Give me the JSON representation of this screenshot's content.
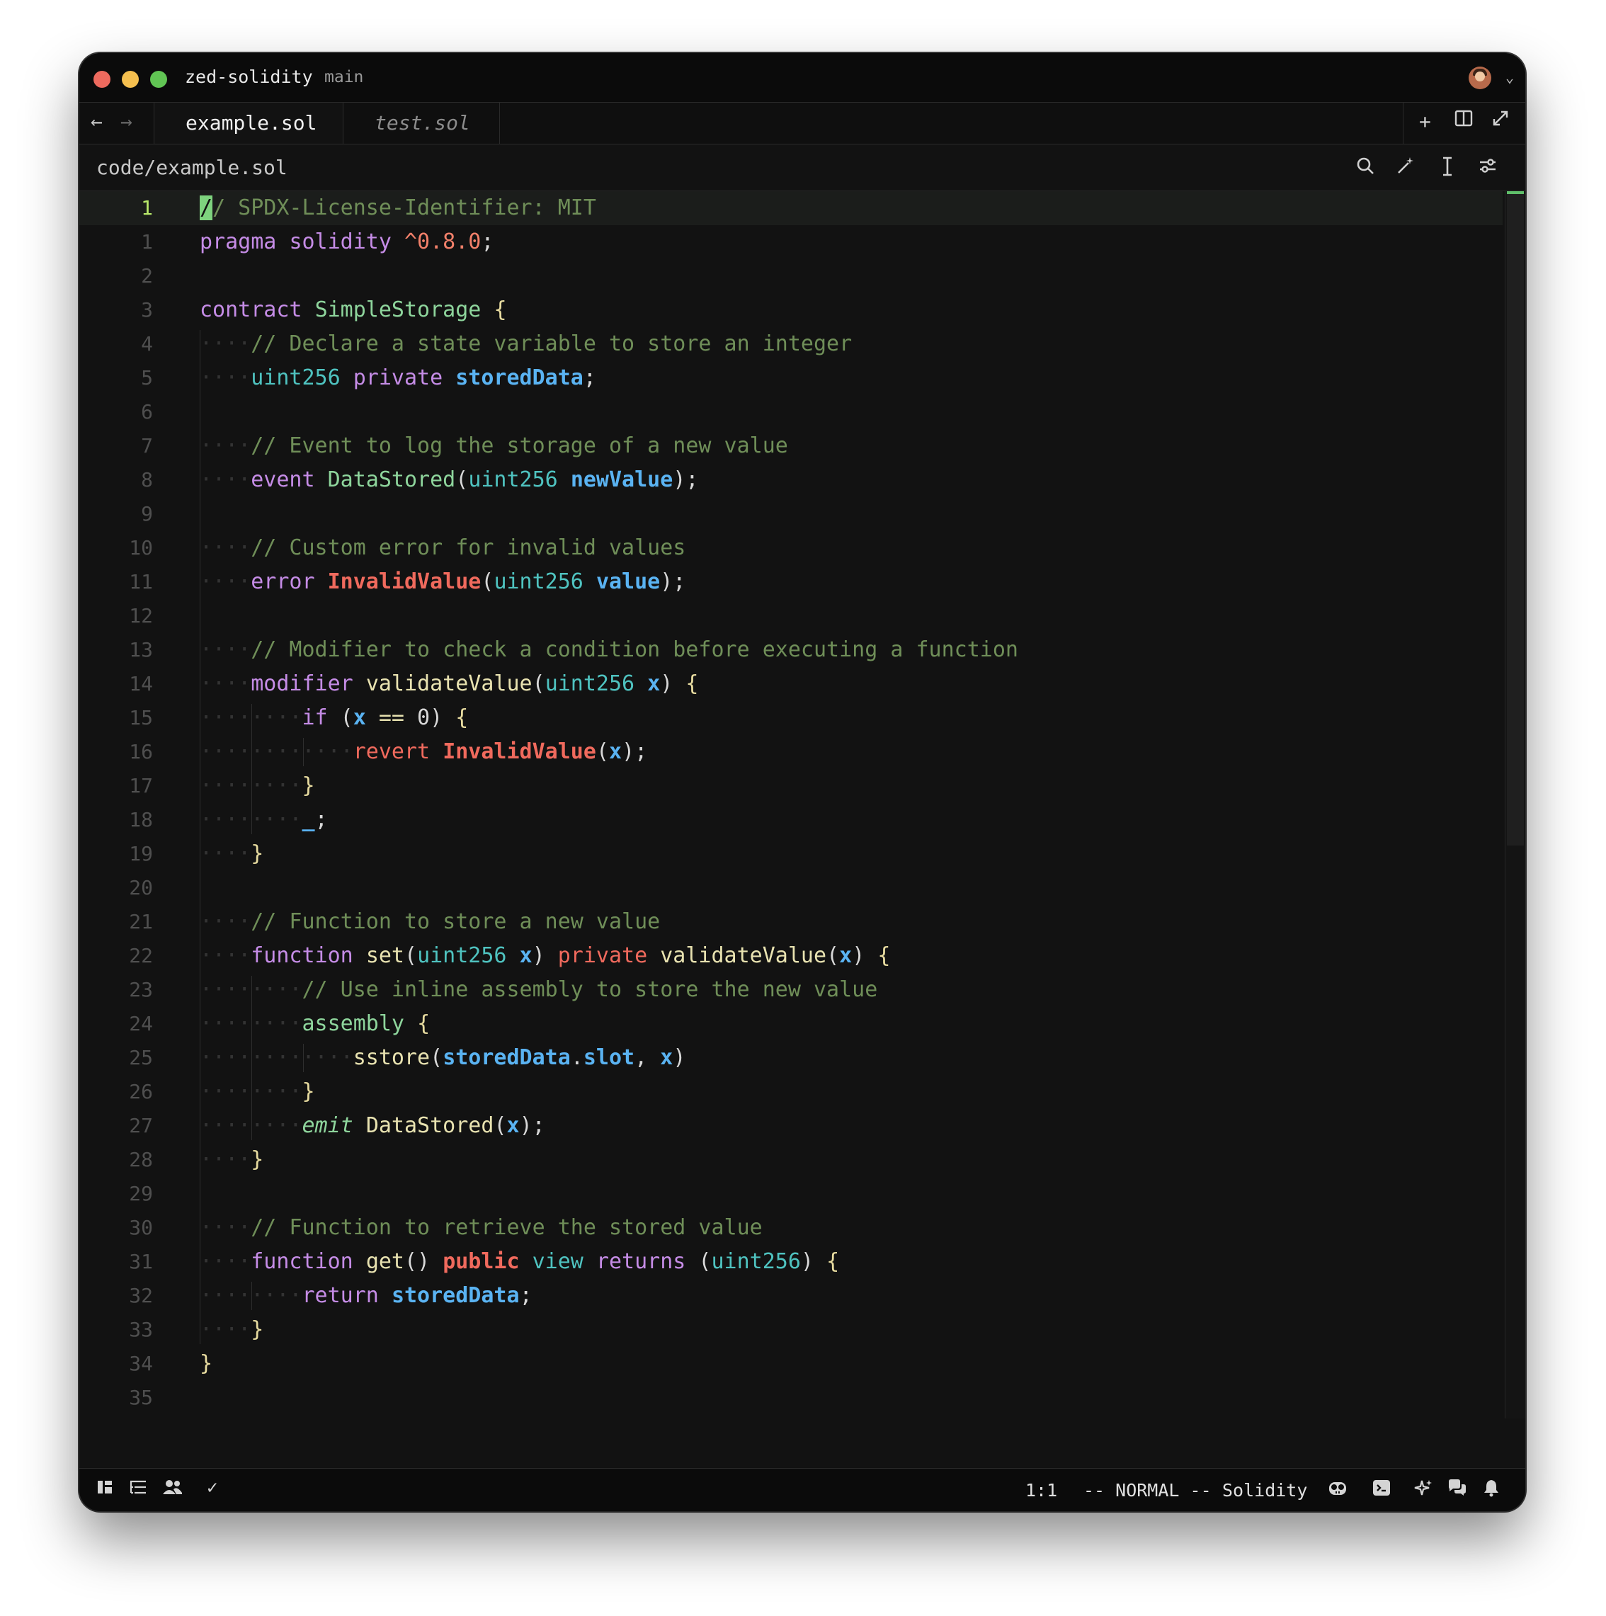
{
  "titlebar": {
    "project": "zed-solidity",
    "branch": "main"
  },
  "tabs": [
    {
      "label": "example.sol",
      "active": true
    },
    {
      "label": "test.sol",
      "active": false
    }
  ],
  "breadcrumb": "code/example.sol",
  "editor": {
    "current_line_number": "1",
    "line_numbers": [
      "1",
      "1",
      "2",
      "3",
      "4",
      "5",
      "6",
      "7",
      "8",
      "9",
      "10",
      "11",
      "12",
      "13",
      "14",
      "15",
      "16",
      "17",
      "18",
      "19",
      "20",
      "21",
      "22",
      "23",
      "24",
      "25",
      "26",
      "27",
      "28",
      "29",
      "30",
      "31",
      "32",
      "33",
      "34",
      "35"
    ],
    "lines": [
      [
        {
          "t": "/",
          "c": "cursor"
        },
        {
          "t": "/ SPDX-License-Identifier: MIT",
          "c": "c-com"
        }
      ],
      [
        {
          "t": "pragma",
          "c": "c-kw"
        },
        {
          "t": " "
        },
        {
          "t": "solidity",
          "c": "c-kw"
        },
        {
          "t": " "
        },
        {
          "t": "^0.8.0",
          "c": "c-num"
        },
        {
          "t": ";",
          "c": "c-punc"
        }
      ],
      [],
      [
        {
          "t": "contract",
          "c": "c-kw"
        },
        {
          "t": " "
        },
        {
          "t": "SimpleStorage",
          "c": "c-con"
        },
        {
          "t": " "
        },
        {
          "t": "{",
          "c": "c-brace"
        }
      ],
      [
        {
          "t": "····",
          "c": "dots"
        },
        {
          "t": "// Declare a state variable to store an integer",
          "c": "c-com"
        }
      ],
      [
        {
          "t": "····",
          "c": "dots"
        },
        {
          "t": "uint256",
          "c": "c-type"
        },
        {
          "t": " "
        },
        {
          "t": "private",
          "c": "c-kw"
        },
        {
          "t": " "
        },
        {
          "t": "storedData",
          "c": "c-var"
        },
        {
          "t": ";",
          "c": "c-punc"
        }
      ],
      [],
      [
        {
          "t": "····",
          "c": "dots"
        },
        {
          "t": "// Event to log the storage of a new value",
          "c": "c-com"
        }
      ],
      [
        {
          "t": "····",
          "c": "dots"
        },
        {
          "t": "event",
          "c": "c-kw"
        },
        {
          "t": " "
        },
        {
          "t": "DataStored",
          "c": "c-con"
        },
        {
          "t": "(",
          "c": "c-punc"
        },
        {
          "t": "uint256",
          "c": "c-type"
        },
        {
          "t": " "
        },
        {
          "t": "newValue",
          "c": "c-var"
        },
        {
          "t": ");",
          "c": "c-punc"
        }
      ],
      [],
      [
        {
          "t": "····",
          "c": "dots"
        },
        {
          "t": "// Custom error for invalid values",
          "c": "c-com"
        }
      ],
      [
        {
          "t": "····",
          "c": "dots"
        },
        {
          "t": "error",
          "c": "c-kw"
        },
        {
          "t": " "
        },
        {
          "t": "InvalidValue",
          "c": "c-err"
        },
        {
          "t": "(",
          "c": "c-punc"
        },
        {
          "t": "uint256",
          "c": "c-type"
        },
        {
          "t": " "
        },
        {
          "t": "value",
          "c": "c-var"
        },
        {
          "t": ");",
          "c": "c-punc"
        }
      ],
      [],
      [
        {
          "t": "····",
          "c": "dots"
        },
        {
          "t": "// Modifier to check a condition before executing a function",
          "c": "c-com"
        }
      ],
      [
        {
          "t": "····",
          "c": "dots"
        },
        {
          "t": "modifier",
          "c": "c-kw"
        },
        {
          "t": " "
        },
        {
          "t": "validateValue",
          "c": "c-fn"
        },
        {
          "t": "(",
          "c": "c-punc"
        },
        {
          "t": "uint256",
          "c": "c-type"
        },
        {
          "t": " "
        },
        {
          "t": "x",
          "c": "c-var"
        },
        {
          "t": ") ",
          "c": "c-punc"
        },
        {
          "t": "{",
          "c": "c-brace"
        }
      ],
      [
        {
          "t": "········",
          "c": "dots"
        },
        {
          "t": "if",
          "c": "c-kw"
        },
        {
          "t": " ("
        },
        {
          "t": "x",
          "c": "c-var"
        },
        {
          "t": " "
        },
        {
          "t": "==",
          "c": "c-fn"
        },
        {
          "t": " 0) "
        },
        {
          "t": "{",
          "c": "c-brace"
        }
      ],
      [
        {
          "t": "············",
          "c": "dots"
        },
        {
          "t": "revert",
          "c": "c-red"
        },
        {
          "t": " "
        },
        {
          "t": "InvalidValue",
          "c": "c-err"
        },
        {
          "t": "(",
          "c": "c-punc"
        },
        {
          "t": "x",
          "c": "c-var"
        },
        {
          "t": ");",
          "c": "c-punc"
        }
      ],
      [
        {
          "t": "········",
          "c": "dots"
        },
        {
          "t": "}",
          "c": "c-brace"
        }
      ],
      [
        {
          "t": "········",
          "c": "dots"
        },
        {
          "t": "_",
          "c": "c-var"
        },
        {
          "t": ";",
          "c": "c-punc"
        }
      ],
      [
        {
          "t": "····",
          "c": "dots"
        },
        {
          "t": "}",
          "c": "c-brace"
        }
      ],
      [],
      [
        {
          "t": "····",
          "c": "dots"
        },
        {
          "t": "// Function to store a new value",
          "c": "c-com"
        }
      ],
      [
        {
          "t": "····",
          "c": "dots"
        },
        {
          "t": "function",
          "c": "c-kw"
        },
        {
          "t": " "
        },
        {
          "t": "set",
          "c": "c-fn"
        },
        {
          "t": "(",
          "c": "c-punc"
        },
        {
          "t": "uint256",
          "c": "c-type"
        },
        {
          "t": " "
        },
        {
          "t": "x",
          "c": "c-var"
        },
        {
          "t": ") ",
          "c": "c-punc"
        },
        {
          "t": "private",
          "c": "c-red"
        },
        {
          "t": " "
        },
        {
          "t": "validateValue",
          "c": "c-fn"
        },
        {
          "t": "(",
          "c": "c-punc"
        },
        {
          "t": "x",
          "c": "c-var"
        },
        {
          "t": ") ",
          "c": "c-punc"
        },
        {
          "t": "{",
          "c": "c-brace"
        }
      ],
      [
        {
          "t": "········",
          "c": "dots"
        },
        {
          "t": "// Use inline assembly to store the new value",
          "c": "c-com"
        }
      ],
      [
        {
          "t": "········",
          "c": "dots"
        },
        {
          "t": "assembly",
          "c": "c-con"
        },
        {
          "t": " "
        },
        {
          "t": "{",
          "c": "c-brace"
        }
      ],
      [
        {
          "t": "············",
          "c": "dots"
        },
        {
          "t": "sstore",
          "c": "c-fn"
        },
        {
          "t": "(",
          "c": "c-punc"
        },
        {
          "t": "storedData",
          "c": "c-var"
        },
        {
          "t": ".",
          "c": "c-punc"
        },
        {
          "t": "slot",
          "c": "c-var"
        },
        {
          "t": ", ",
          "c": "c-punc"
        },
        {
          "t": "x",
          "c": "c-var"
        },
        {
          "t": ")",
          "c": "c-punc"
        }
      ],
      [
        {
          "t": "········",
          "c": "dots"
        },
        {
          "t": "}",
          "c": "c-brace"
        }
      ],
      [
        {
          "t": "········",
          "c": "dots"
        },
        {
          "t": "emit",
          "c": "c-emit"
        },
        {
          "t": " "
        },
        {
          "t": "DataStored",
          "c": "c-fn"
        },
        {
          "t": "(",
          "c": "c-punc"
        },
        {
          "t": "x",
          "c": "c-var"
        },
        {
          "t": ");",
          "c": "c-punc"
        }
      ],
      [
        {
          "t": "····",
          "c": "dots"
        },
        {
          "t": "}",
          "c": "c-brace"
        }
      ],
      [],
      [
        {
          "t": "····",
          "c": "dots"
        },
        {
          "t": "// Function to retrieve the stored value",
          "c": "c-com"
        }
      ],
      [
        {
          "t": "····",
          "c": "dots"
        },
        {
          "t": "function",
          "c": "c-kw"
        },
        {
          "t": " "
        },
        {
          "t": "get",
          "c": "c-fn"
        },
        {
          "t": "() ",
          "c": "c-punc"
        },
        {
          "t": "public",
          "c": "c-pub"
        },
        {
          "t": " "
        },
        {
          "t": "view",
          "c": "c-type"
        },
        {
          "t": " "
        },
        {
          "t": "returns",
          "c": "c-kw"
        },
        {
          "t": " ("
        },
        {
          "t": "uint256",
          "c": "c-type"
        },
        {
          "t": ") "
        },
        {
          "t": "{",
          "c": "c-brace"
        }
      ],
      [
        {
          "t": "········",
          "c": "dots"
        },
        {
          "t": "return",
          "c": "c-ret"
        },
        {
          "t": " "
        },
        {
          "t": "storedData",
          "c": "c-var"
        },
        {
          "t": ";",
          "c": "c-punc"
        }
      ],
      [
        {
          "t": "····",
          "c": "dots"
        },
        {
          "t": "}",
          "c": "c-brace"
        }
      ],
      [
        {
          "t": "}",
          "c": "c-brace"
        }
      ],
      []
    ]
  },
  "statusbar": {
    "cursor_position": "1:1",
    "mode": "-- NORMAL --",
    "language": "Solidity",
    "check_mark": "✓"
  },
  "colors": {
    "accent_green": "#7ed37e",
    "background": "#121212"
  }
}
